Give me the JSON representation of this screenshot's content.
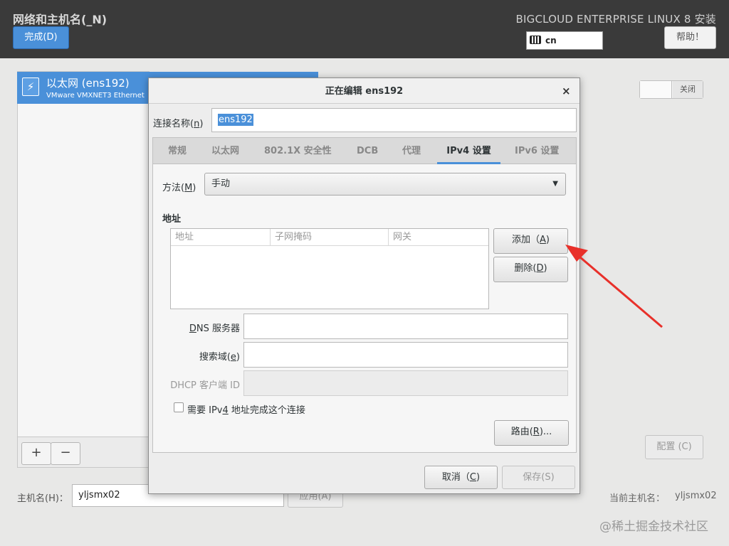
{
  "header": {
    "title": "网络和主机名(_N)",
    "done_label": "完成(D)",
    "product": "BIGCLOUD ENTERPRISE LINUX 8 安装",
    "keyboard_layout": "cn",
    "help_label": "帮助！"
  },
  "device": {
    "name": "以太网 (ens192)",
    "description": "VMware VMXNET3 Ethernet C",
    "toggle_label": "关闭",
    "add_label": "+",
    "remove_label": "−"
  },
  "configure_label": "配置 (C)",
  "hostname": {
    "label": "主机名(H)：",
    "value": "yljsmx02",
    "apply_label": "应用(A)",
    "current_label": "当前主机名：",
    "current_value": "yljsmx02"
  },
  "watermark": "@稀土掘金技术社区",
  "dialog": {
    "title": "正在编辑 ens192",
    "close": "×",
    "connection_name_label": "连接名称(",
    "connection_name_key": "n",
    "connection_name_value": "ens192",
    "tabs": [
      "常规",
      "以太网",
      "802.1X 安全性",
      "DCB",
      "代理",
      "IPv4 设置",
      "IPv6 设置"
    ],
    "active_tab": "IPv4 设置",
    "method_label": "方法(",
    "method_key": "M",
    "method_value": "手动",
    "addresses_heading": "地址",
    "address_columns": [
      "地址",
      "子网掩码",
      "网关"
    ],
    "add_label": "添加（",
    "add_key": "A",
    "delete_label": "删除(",
    "delete_key": "D",
    "dns_key": "D",
    "dns_label": "NS 服务器",
    "search_label": "搜索域(",
    "search_key": "e",
    "dhcp_label": "DHCP 客户端 ID",
    "require_label_pre": "需要 IPv",
    "require_key": "4",
    "require_label_post": " 地址完成这个连接",
    "routes_label": "路由(",
    "routes_key": "R",
    "cancel_label": "取消（",
    "cancel_key": "C",
    "save_label": "保存(S)"
  },
  "colors": {
    "accent": "#4a90d9",
    "topbar": "#3a3a3a",
    "arrow": "#e8302a"
  }
}
